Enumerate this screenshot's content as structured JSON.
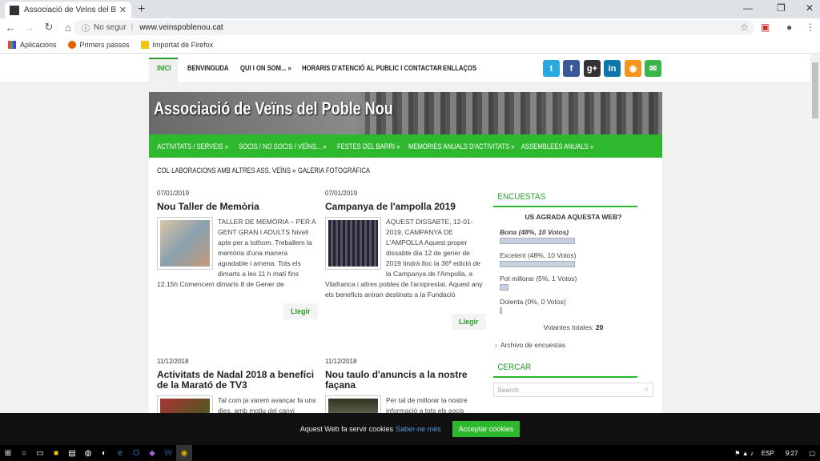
{
  "browser": {
    "tab_title": "Associació de Veïns del Barri del P",
    "new_tab": "+",
    "window_controls": [
      "—",
      "❐",
      "✕"
    ],
    "security_label": "No segur",
    "url": "www.veinspoblenou.cat",
    "bookmarks": [
      "Aplicacions",
      "Primers passos",
      "Importat de Firefox"
    ]
  },
  "topnav": {
    "items": [
      "INICI",
      "BENVINGUDA",
      "QUI I ON SOM... »",
      "HORARIS D'ATENCIÓ AL PUBLIC I CONTACTAR",
      "ENLLAÇOS"
    ],
    "social": [
      {
        "icon": "twitter-icon",
        "glyph": "t",
        "color": "#29a9e1"
      },
      {
        "icon": "facebook-icon",
        "glyph": "f",
        "color": "#3b5998"
      },
      {
        "icon": "googleplus-icon",
        "glyph": "g+",
        "color": "#333333"
      },
      {
        "icon": "linkedin-icon",
        "glyph": "in",
        "color": "#0e76a8"
      },
      {
        "icon": "rss-icon",
        "glyph": "◉",
        "color": "#f7941e"
      },
      {
        "icon": "email-icon",
        "glyph": "✉",
        "color": "#3bb54a"
      }
    ]
  },
  "banner": {
    "title": "Associació de Veïns del Poble Nou"
  },
  "greennav": {
    "items": [
      "ACTIVITATS / SERVEIS »",
      "SOCIS / NO SOCIS / VEÏNS... »",
      "FESTES DEL BARRI »",
      "MEMÒRIES ANUALS D'ACTIVITATS »",
      "ASSEMBLEES ANUALS »"
    ]
  },
  "subnav": {
    "items": [
      "COL·LABORACIONS AMB ALTRES ASS. VEÏNS »",
      "GALERIA FOTOGRÀFICA"
    ]
  },
  "posts": [
    {
      "date": "07/01/2019",
      "title": "Nou Taller de Memòria",
      "body": "TALLER DE MEMÒRIA – PER A GENT GRAN I ADULTS Nivell apte per a tothom. Treballem la memòria d'una manera agradable i amena. Tots els dimarts a les 11 h matí fins 12.15h Comencem dimarts 8 de Gener de",
      "read_more": "Llegir"
    },
    {
      "date": "07/01/2019",
      "title": "Campanya de l'ampolla 2019",
      "body": "AQUEST DISSABTE, 12-01-2019, CAMPANYA DE L'AMPOLLA Aquest proper dissabte dia 12 de gener de 2019 tindrà lloc la 36ª edició de la Campanya de l'Ampolla, a Vilafranca i altres pobles de l'arxiprestat.  Aquest any els beneficis aniran destinats a la Fundació",
      "read_more": "Llegir"
    },
    {
      "date": "11/12/2018",
      "title": "Activitats de Nadal 2018 a benefíci de la Marató de TV3",
      "body": "Tal com ja varem avançar fa uns dies, amb motiu del canvi proposat"
    },
    {
      "date": "11/12/2018",
      "title": "Nou taulo d'anuncis a la nostre façana",
      "body": "Per tal de millorar la nostre informació a tots els socis"
    }
  ],
  "sidebar": {
    "poll_title": "ENCUESTAS",
    "poll_question": "US AGRADA AQUESTA WEB?",
    "options": [
      {
        "label": "Bona (48%, 10 Votos)",
        "fraction": 0.48
      },
      {
        "label": "Excelent (48%, 10 Votos)",
        "fraction": 0.48
      },
      {
        "label": "Pot millorar (5%, 1 Votos)",
        "fraction": 0.05
      },
      {
        "label": "Dolenta (0%, 0 Votos)",
        "fraction": 0.0
      }
    ],
    "total_label": "Votantes totales:",
    "total_value": "20",
    "archive_link": "Archivo de encuestas",
    "search_title": "CERCAR",
    "search_placeholder": "Search"
  },
  "cookie": {
    "message": "Aquest Web fa servir cookies",
    "more_link": "Saber-ne més",
    "accept": "Acceptar cookies"
  },
  "taskbar": {
    "language": "ESP",
    "time": "9:27"
  }
}
